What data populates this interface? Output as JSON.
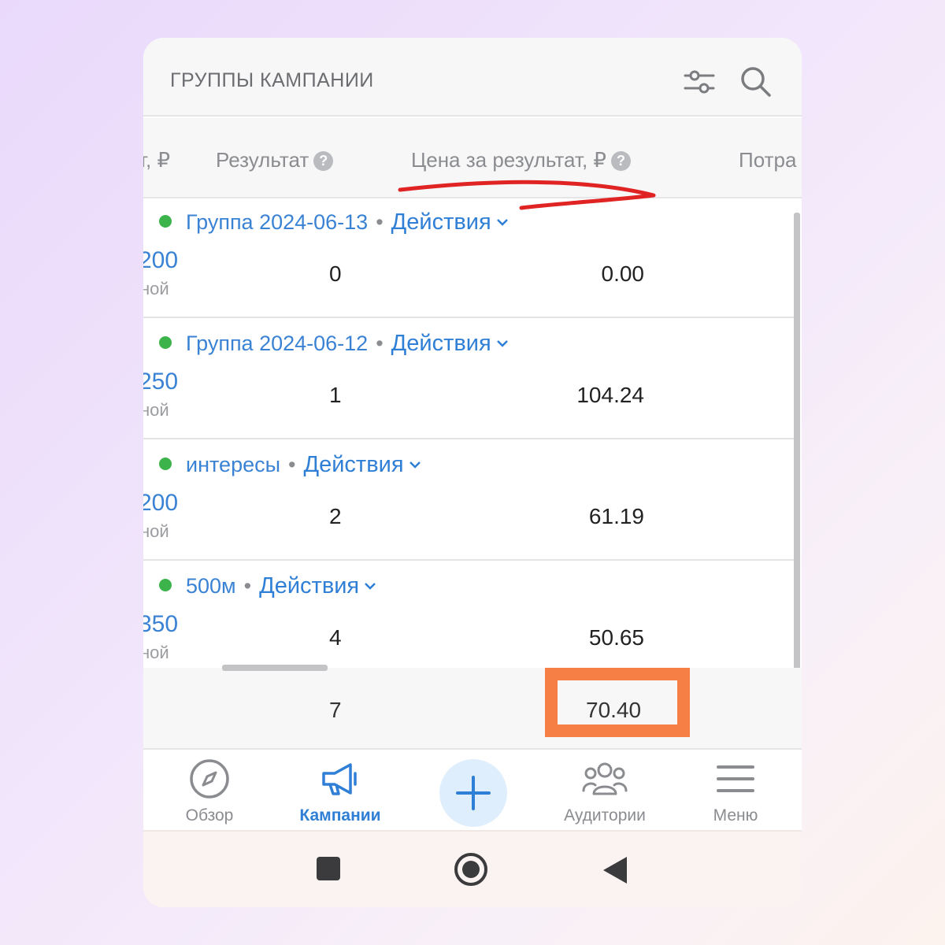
{
  "header": {
    "title": "ГРУППЫ КАМПАНИИ",
    "filter_icon": "sliders-icon",
    "search_icon": "search-icon"
  },
  "columns": {
    "clipped_left": "т, ₽",
    "result": "Результат",
    "price": "Цена за результат, ₽",
    "clipped_right": "Потра"
  },
  "rows": [
    {
      "name": "Группа 2024-06-13",
      "actions": "Действия",
      "clip_value": "200",
      "clip_sub": "ной",
      "result": "0",
      "price": "0.00",
      "status_color": "#3cb44b"
    },
    {
      "name": "Группа 2024-06-12",
      "actions": "Действия",
      "clip_value": "250",
      "clip_sub": "ной",
      "result": "1",
      "price": "104.24",
      "status_color": "#3cb44b"
    },
    {
      "name": "интересы",
      "actions": "Действия",
      "clip_value": "200",
      "clip_sub": "ной",
      "result": "2",
      "price": "61.19",
      "status_color": "#3cb44b"
    },
    {
      "name": "500м",
      "actions": "Действия",
      "clip_value": "350",
      "clip_sub": "ной",
      "result": "4",
      "price": "50.65",
      "status_color": "#3cb44b"
    }
  ],
  "totals": {
    "result": "7",
    "price": "70.40"
  },
  "nav": {
    "overview": "Обзор",
    "campaigns": "Кампании",
    "audiences": "Аудитории",
    "menu": "Меню"
  },
  "colors": {
    "accent": "#2f7fd6",
    "highlight": "#f57f45",
    "arrow": "#e02424",
    "status_active": "#3cb44b"
  }
}
